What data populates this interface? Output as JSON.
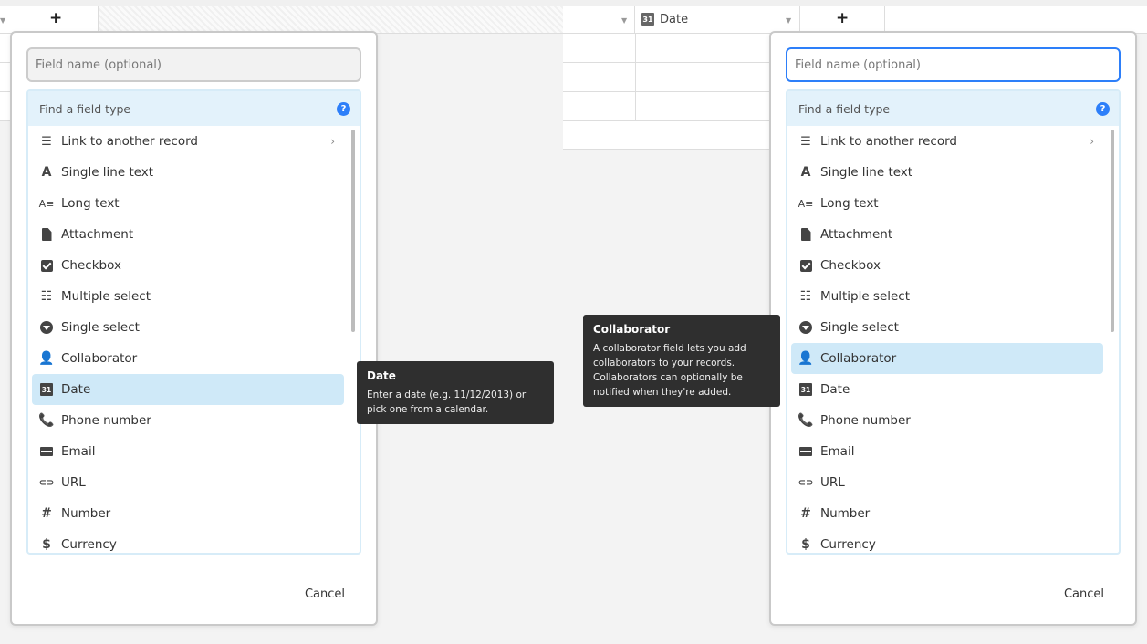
{
  "grid": {
    "add_column": "+",
    "date_column_label": "Date",
    "date_icon": "31"
  },
  "left_panel": {
    "field_name_placeholder": "Field name (optional)",
    "search_placeholder": "Find a field type",
    "help_icon": "?",
    "items": [
      {
        "label": "Link to another record",
        "icon": "link-record-icon",
        "glyph": "☰"
      },
      {
        "label": "Single line text",
        "icon": "text-a-icon",
        "glyph": "A"
      },
      {
        "label": "Long text",
        "icon": "long-text-icon",
        "glyph": "A≡"
      },
      {
        "label": "Attachment",
        "icon": "attachment-icon",
        "glyph": ""
      },
      {
        "label": "Checkbox",
        "icon": "checkbox-icon",
        "glyph": ""
      },
      {
        "label": "Multiple select",
        "icon": "multiple-select-icon",
        "glyph": "☷"
      },
      {
        "label": "Single select",
        "icon": "single-select-icon",
        "glyph": ""
      },
      {
        "label": "Collaborator",
        "icon": "person-icon",
        "glyph": "👤"
      },
      {
        "label": "Date",
        "icon": "calendar-icon",
        "glyph": "31"
      },
      {
        "label": "Phone number",
        "icon": "phone-icon",
        "glyph": "📞"
      },
      {
        "label": "Email",
        "icon": "envelope-icon",
        "glyph": ""
      },
      {
        "label": "URL",
        "icon": "link-icon",
        "glyph": "⊂⊃"
      },
      {
        "label": "Number",
        "icon": "hash-icon",
        "glyph": "#"
      },
      {
        "label": "Currency",
        "icon": "currency-icon",
        "glyph": "$"
      }
    ],
    "selected_item": "Date",
    "cancel_label": "Cancel"
  },
  "right_panel": {
    "field_name_placeholder": "Field name (optional)",
    "search_placeholder": "Find a field type",
    "help_icon": "?",
    "selected_item": "Collaborator",
    "cancel_label": "Cancel"
  },
  "tooltips": {
    "date": {
      "title": "Date",
      "description": "Enter a date (e.g. 11/12/2013) or pick one from a calendar."
    },
    "collaborator": {
      "title": "Collaborator",
      "description": "A collaborator field lets you add collaborators to your records. Collaborators can optionally be notified when they're added."
    }
  },
  "colors": {
    "accent": "#2d7ff9",
    "selected_bg": "#cfe9f8",
    "search_bg": "#e3f2fb",
    "tooltip_bg": "#2f2f2f"
  }
}
